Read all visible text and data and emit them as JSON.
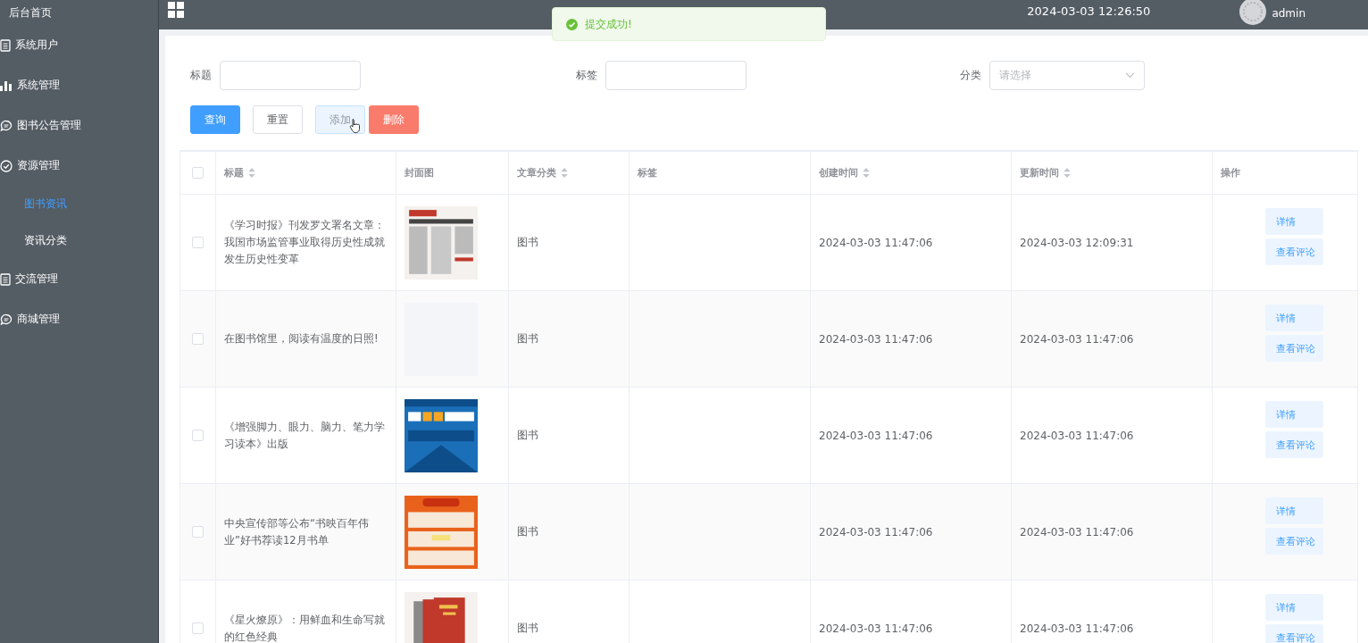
{
  "sidebar": {
    "home": "后台首页",
    "items": [
      {
        "label": "系统用户"
      },
      {
        "label": "系统管理"
      },
      {
        "label": "图书公告管理"
      },
      {
        "label": "资源管理",
        "children": [
          {
            "label": "图书资讯",
            "selected": true
          },
          {
            "label": "资讯分类",
            "selected": false
          }
        ]
      },
      {
        "label": "交流管理"
      },
      {
        "label": "商城管理"
      }
    ]
  },
  "header": {
    "datetime": "2024-03-03 12:26:50",
    "user": "admin"
  },
  "toast": {
    "message": "提交成功!"
  },
  "filters": [
    {
      "label": "标题",
      "kind": "text"
    },
    {
      "label": "标签",
      "kind": "text"
    },
    {
      "label": "分类",
      "kind": "select",
      "placeholder": "请选择"
    }
  ],
  "buttons": [
    {
      "label": "查询",
      "kind": "primary"
    },
    {
      "label": "重置",
      "kind": "default"
    },
    {
      "label": "添加",
      "kind": "hover"
    },
    {
      "label": "删除",
      "kind": "danger"
    }
  ],
  "table": {
    "select_all_checked": false,
    "columns": [
      {
        "label": "标题",
        "sortable": true
      },
      {
        "label": "封面图",
        "sortable": false
      },
      {
        "label": "文章分类",
        "sortable": true
      },
      {
        "label": "标签",
        "sortable": false
      },
      {
        "label": "创建时间",
        "sortable": true
      },
      {
        "label": "更新时间",
        "sortable": true
      },
      {
        "label": "操作",
        "sortable": false
      }
    ],
    "rows": [
      {
        "checked": false,
        "title": "《学习时报》刊发罗文署名文章：我国市场监管事业取得历史性成就发生历史性变革",
        "cover": {
          "kind": "picture"
        },
        "category": "图书",
        "created": "2024-03-03 11:47:06",
        "updated": "2024-03-03 12:09:31",
        "actions": [
          "详情",
          "查看评论"
        ]
      },
      {
        "checked": false,
        "title": "在图书馆里，阅读有温度的日照!",
        "cover": {
          "kind": "placeholder"
        },
        "category": "图书",
        "created": "2024-03-03 11:47:06",
        "updated": "2024-03-03 11:47:06",
        "actions": [
          "详情",
          "查看评论"
        ]
      },
      {
        "checked": false,
        "title": "《增强脚力、眼力、脑力、笔力学习读本》出版",
        "cover": {
          "kind": "picture"
        },
        "category": "图书",
        "created": "2024-03-03 11:47:06",
        "updated": "2024-03-03 11:47:06",
        "actions": [
          "详情",
          "查看评论"
        ]
      },
      {
        "checked": false,
        "title": "中央宣传部等公布“书映百年伟业”好书荐读12月书单",
        "cover": {
          "kind": "picture"
        },
        "category": "图书",
        "created": "2024-03-03 11:47:06",
        "updated": "2024-03-03 11:47:06",
        "actions": [
          "详情",
          "查看评论"
        ]
      },
      {
        "checked": false,
        "title": "《星火燎原》：用鲜血和生命写就的红色经典",
        "cover": {
          "kind": "picture"
        },
        "category": "图书",
        "created": "2024-03-03 11:47:06",
        "updated": "2024-03-03 11:47:06",
        "actions": [
          "详情",
          "查看评论"
        ]
      }
    ]
  }
}
